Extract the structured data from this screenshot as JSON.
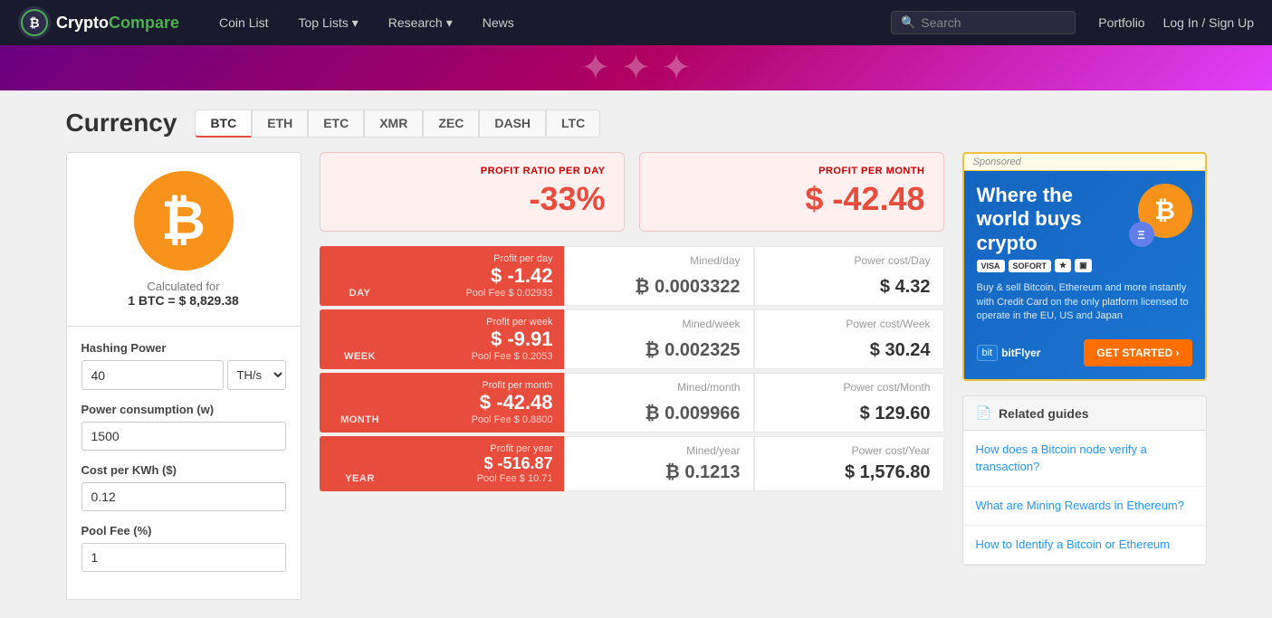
{
  "navbar": {
    "brand": "CryptoCompare",
    "brand_crypto": "Crypto",
    "brand_compare": "Compare",
    "links": [
      {
        "label": "Coin List",
        "id": "coin-list"
      },
      {
        "label": "Top Lists",
        "id": "top-lists",
        "has_dropdown": true
      },
      {
        "label": "Research",
        "id": "research",
        "has_dropdown": true
      },
      {
        "label": "News",
        "id": "news"
      }
    ],
    "search_placeholder": "Search",
    "portfolio": "Portfolio",
    "login": "Log In / Sign Up"
  },
  "currency": {
    "title": "Currency",
    "tabs": [
      "BTC",
      "ETH",
      "ETC",
      "XMR",
      "ZEC",
      "DASH",
      "LTC"
    ],
    "active_tab": "BTC"
  },
  "coin_display": {
    "calc_label": "Calculated for",
    "calc_value": "1 BTC = $ 8,829.38"
  },
  "form": {
    "hashing_power_label": "Hashing Power",
    "hashing_power_value": "40",
    "hashing_power_unit": "TH/s",
    "power_consumption_label": "Power consumption (w)",
    "power_consumption_value": "1500",
    "cost_per_kwh_label": "Cost per KWh ($)",
    "cost_per_kwh_value": "0.12",
    "pool_fee_label": "Pool Fee (%)",
    "pool_fee_value": "1"
  },
  "profit_summary": {
    "ratio_label": "PROFIT RATIO PER DAY",
    "ratio_value": "-33%",
    "month_label": "PROFIT PER MONTH",
    "month_value": "$ -42.48"
  },
  "rows": [
    {
      "period": "Day",
      "profit_label": "Profit per day",
      "profit_value": "$ -1.42",
      "pool_fee": "Pool Fee $ 0.02933",
      "mined_label": "Mined/day",
      "mined_value": "₿ 0.0003322",
      "power_label": "Power cost/Day",
      "power_value": "$ 4.32"
    },
    {
      "period": "Week",
      "profit_label": "Profit per week",
      "profit_value": "$ -9.91",
      "pool_fee": "Pool Fee $ 0.2053",
      "mined_label": "Mined/week",
      "mined_value": "₿ 0.002325",
      "power_label": "Power cost/Week",
      "power_value": "$ 30.24"
    },
    {
      "period": "Month",
      "profit_label": "Profit per month",
      "profit_value": "$ -42.48",
      "pool_fee": "Pool Fee $ 0.8800",
      "mined_label": "Mined/month",
      "mined_value": "₿ 0.009966",
      "power_label": "Power cost/Month",
      "power_value": "$ 129.60"
    },
    {
      "period": "Year",
      "profit_label": "Profit per year",
      "profit_value": "$ -516.87",
      "pool_fee": "Pool Fee $ 10.71",
      "mined_label": "Mined/year",
      "mined_value": "₿ 0.1213",
      "power_label": "Power cost/Year",
      "power_value": "$ 1,576.80"
    }
  ],
  "ad": {
    "sponsored_label": "Sponsored",
    "title": "Where the world buys crypto",
    "desc": "Buy & sell Bitcoin, Ethereum and more instantly with Credit Card on the only platform licensed to operate in the EU, US and Japan",
    "payments": [
      "VISA",
      "SOFORT"
    ],
    "brand": "bitFlyer",
    "cta": "GET STARTED ›"
  },
  "related_guides": {
    "header": "Related guides",
    "links": [
      "How does a Bitcoin node verify a transaction?",
      "What are Mining Rewards in Ethereum?",
      "How to Identify a Bitcoin or Ethereum"
    ]
  }
}
